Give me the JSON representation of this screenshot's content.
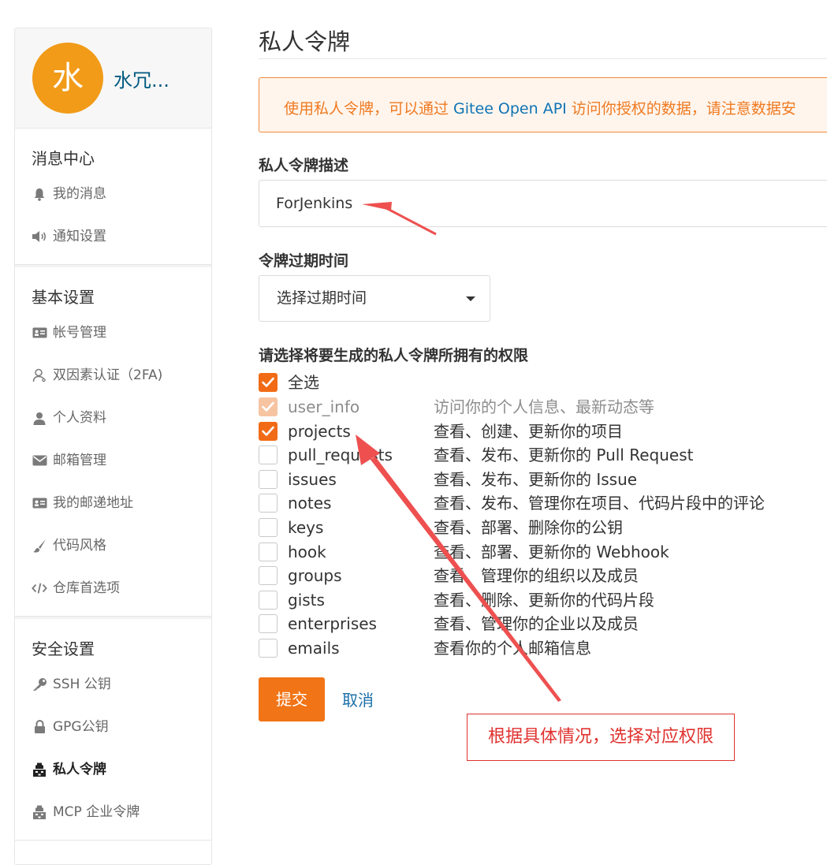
{
  "sidebar": {
    "avatar_char": "水",
    "username": "水冗...",
    "sections": [
      {
        "title": "消息中心",
        "items": [
          {
            "label": "我的消息",
            "icon": "bell-icon"
          },
          {
            "label": "通知设置",
            "icon": "speaker-icon"
          }
        ]
      },
      {
        "title": "基本设置",
        "items": [
          {
            "label": "帐号管理",
            "icon": "id-card-icon"
          },
          {
            "label": "双因素认证（2FA)",
            "icon": "user-outline-icon"
          },
          {
            "label": "个人资料",
            "icon": "user-icon"
          },
          {
            "label": "邮箱管理",
            "icon": "envelope-icon"
          },
          {
            "label": "我的邮递地址",
            "icon": "address-card-icon"
          },
          {
            "label": "代码风格",
            "icon": "brush-icon"
          },
          {
            "label": "仓库首选项",
            "icon": "code-icon"
          }
        ]
      },
      {
        "title": "安全设置",
        "items": [
          {
            "label": "SSH 公钥",
            "icon": "key-icon"
          },
          {
            "label": "GPG公钥",
            "icon": "lock-icon"
          },
          {
            "label": "私人令牌",
            "icon": "token-icon",
            "active": true
          },
          {
            "label": "MCP 企业令牌",
            "icon": "token-icon"
          }
        ]
      }
    ]
  },
  "main": {
    "title": "私人令牌",
    "notice_prefix": "使用私人令牌，可以通过 ",
    "notice_brand": "Gitee Open API",
    "notice_suffix": " 访问你授权的数据，请注意数据安",
    "desc_label": "私人令牌描述",
    "desc_value": "ForJenkins",
    "expire_label": "令牌过期时间",
    "expire_value": "选择过期时间",
    "perm_label": "请选择将要生成的私人令牌所拥有的权限",
    "select_all": "全选",
    "permissions": [
      {
        "name": "user_info",
        "desc": "访问你的个人信息、最新动态等",
        "checked": true,
        "disabled": true
      },
      {
        "name": "projects",
        "desc": "查看、创建、更新你的项目",
        "checked": true
      },
      {
        "name": "pull_requests",
        "desc": "查看、发布、更新你的 Pull Request",
        "checked": false
      },
      {
        "name": "issues",
        "desc": "查看、发布、更新你的 Issue",
        "checked": false
      },
      {
        "name": "notes",
        "desc": "查看、发布、管理你在项目、代码片段中的评论",
        "checked": false
      },
      {
        "name": "keys",
        "desc": "查看、部署、删除你的公钥",
        "checked": false
      },
      {
        "name": "hook",
        "desc": "查看、部署、更新你的 Webhook",
        "checked": false
      },
      {
        "name": "groups",
        "desc": "查看、管理你的组织以及成员",
        "checked": false
      },
      {
        "name": "gists",
        "desc": "查看、删除、更新你的代码片段",
        "checked": false
      },
      {
        "name": "enterprises",
        "desc": "查看、管理你的企业以及成员",
        "checked": false
      },
      {
        "name": "emails",
        "desc": "查看你的个人邮箱信息",
        "checked": false
      }
    ],
    "submit_label": "提交",
    "cancel_label": "取消",
    "annotation": "根据具体情况，选择对应权限"
  },
  "colors": {
    "accent": "#f17416",
    "annotation": "#e0322f",
    "link": "#1a6fa8"
  }
}
